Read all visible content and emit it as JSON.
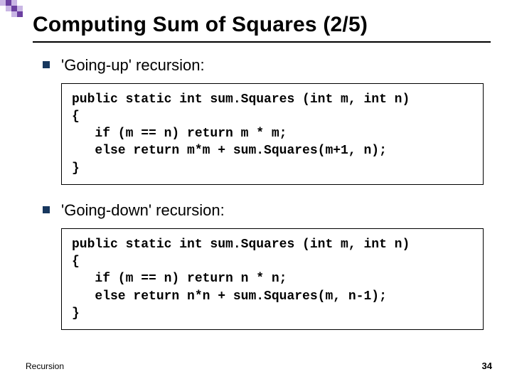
{
  "title": "Computing Sum of Squares (2/5)",
  "sections": [
    {
      "label": "'Going-up' recursion:",
      "code": "public static int sum.Squares (int m, int n)\n{\n   if (m == n) return m * m;\n   else return m*m + sum.Squares(m+1, n);\n}"
    },
    {
      "label": "'Going-down' recursion:",
      "code": "public static int sum.Squares (int m, int n)\n{\n   if (m == n) return n * n;\n   else return n*n + sum.Squares(m, n-1);\n}"
    }
  ],
  "footer_left": "Recursion",
  "footer_right": "34"
}
